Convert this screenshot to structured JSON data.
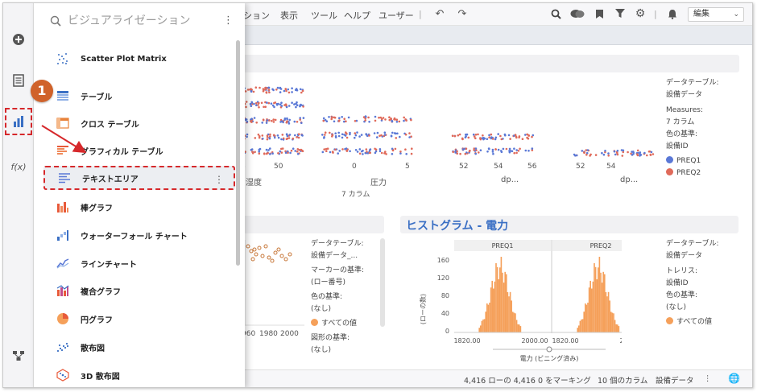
{
  "toolbar": {
    "menu": [
      "ション",
      "表示",
      "ツール",
      "ヘルプ",
      "ユーザー"
    ],
    "mode_label": "編集"
  },
  "flyout": {
    "search_placeholder": "ビジュアライゼーション",
    "items": [
      {
        "label": "Scatter Plot Matrix",
        "icon": "scatter-matrix-icon"
      },
      {
        "label": "テーブル",
        "icon": "table-icon"
      },
      {
        "label": "クロス テーブル",
        "icon": "cross-table-icon"
      },
      {
        "label": "グラフィカル テーブル",
        "icon": "graphical-table-icon"
      },
      {
        "label": "テキストエリア",
        "icon": "text-area-icon"
      },
      {
        "label": "棒グラフ",
        "icon": "bar-chart-icon"
      },
      {
        "label": "ウォーターフォール チャート",
        "icon": "waterfall-chart-icon"
      },
      {
        "label": "ラインチャート",
        "icon": "line-chart-icon"
      },
      {
        "label": "複合グラフ",
        "icon": "combination-chart-icon"
      },
      {
        "label": "円グラフ",
        "icon": "pie-chart-icon"
      },
      {
        "label": "散布図",
        "icon": "scatter-plot-icon"
      },
      {
        "label": "3D 散布図",
        "icon": "scatter-3d-icon"
      }
    ]
  },
  "step": {
    "number": "1"
  },
  "top_panel": {
    "axis_labels": [
      "8",
      "50",
      "0",
      "5",
      "52",
      "54",
      "56",
      "52",
      "54"
    ],
    "col_labels": [
      "湿度",
      "圧力",
      "dp...",
      "dp..."
    ],
    "sub_label": "7 カラム",
    "legend": {
      "table_label": "データテーブル:",
      "table_value": "設備データ",
      "measures_label": "Measures:",
      "measures_value": "7 カラム",
      "color_label": "色の基準:",
      "color_value": "設備ID",
      "series": [
        {
          "name": "PREQ1",
          "color": "#5a78d6"
        },
        {
          "name": "PREQ2",
          "color": "#e06a5a"
        }
      ]
    }
  },
  "scatter_panel": {
    "x_ticks": [
      "960",
      "1980",
      "2000"
    ],
    "legend": {
      "table_label": "データテーブル:",
      "table_value": "設備データ_...",
      "marker_label": "マーカーの基準:",
      "marker_value": "(ロー番号)",
      "color_label": "色の基準:",
      "color_value": "(なし)",
      "all_values": "すべての値",
      "shape_label": "図形の基準:",
      "shape_value": "(なし)"
    }
  },
  "histogram": {
    "title": "ヒストグラム - 電力",
    "ylabel": "(ローの数)",
    "xlabel": "電力 (ビニング済み)",
    "panels": [
      "PREQ1",
      "PREQ2"
    ],
    "y_ticks": [
      "160",
      "120",
      "80",
      "40",
      "0"
    ],
    "x_ticks": [
      "1820.00",
      "2000.00"
    ],
    "bar_color": "#f5a05a",
    "legend": {
      "table_label": "データテーブル:",
      "table_value": "設備データ",
      "trellis_label": "トレリス:",
      "trellis_value": "設備ID",
      "color_label": "色の基準:",
      "color_value": "(なし)",
      "all_values": "すべての値"
    }
  },
  "status": {
    "rows": "4,416 ローの 4,416",
    "marking": "0 をマーキング",
    "columns": "10 個のカラム",
    "table": "設備データ"
  }
}
